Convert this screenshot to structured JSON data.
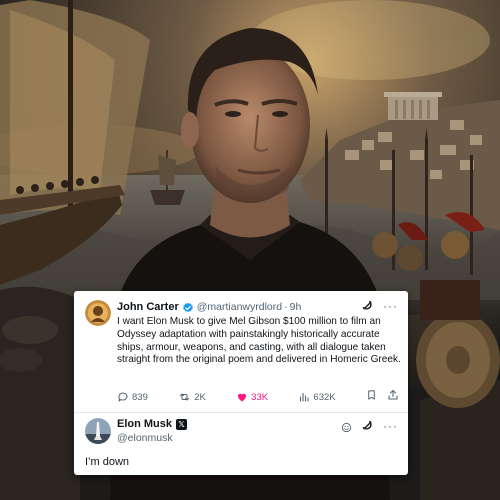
{
  "tweet": {
    "author_name": "John Carter",
    "author_handle": "@martianwyrdlord",
    "separator": "·",
    "time": "9h",
    "text": "I want Elon Musk to give Mel Gibson $100 million to film an Odyssey adaptation with painstakingly historically accurate ships, armour, weapons, and casting, with all dialogue taken straight from the original poem and delivered in Homeric Greek.",
    "more_glyph": "···",
    "replies": "839",
    "reposts": "2K",
    "likes": "33K",
    "views": "632K"
  },
  "reply": {
    "author_name": "Elon Musk",
    "badge_glyph": "𝕏",
    "author_handle": "@elonmusk",
    "more_glyph": "···",
    "text": "I’m down"
  },
  "colors": {
    "verified": "#1d9bf0",
    "like": "#f91880",
    "muted": "#536471",
    "text": "#0f1419"
  },
  "icons": [
    "verified-badge-icon",
    "grok-icon",
    "more-icon",
    "reply-icon",
    "repost-icon",
    "like-icon",
    "views-icon",
    "bookmark-icon",
    "share-icon",
    "x-badge-icon",
    "smile-icon"
  ]
}
